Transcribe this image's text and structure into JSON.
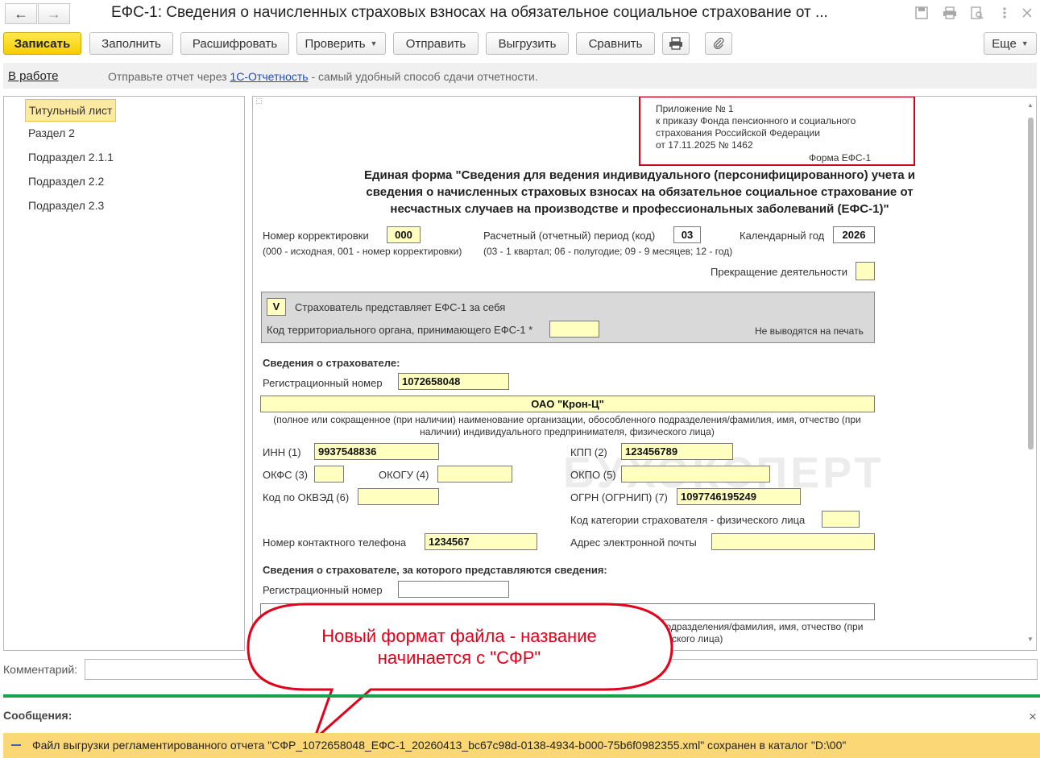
{
  "window": {
    "title": "ЕФС-1: Сведения о начисленных страховых взносах на обязательное социальное страхование от ..."
  },
  "toolbar": {
    "save": "Записать",
    "fill": "Заполнить",
    "decode": "Расшифровать",
    "check": "Проверить",
    "send": "Отправить",
    "export": "Выгрузить",
    "compare": "Сравнить",
    "more": "Еще"
  },
  "infobar": {
    "status_link": "В работе",
    "prefix": "Отправьте отчет через ",
    "link": "1С-Отчетность",
    "suffix": " - самый удобный способ сдачи отчетности."
  },
  "sidebar": {
    "items": [
      {
        "label": "Титульный лист"
      },
      {
        "label": "Раздел 2"
      },
      {
        "label": "Подраздел 2.1.1"
      },
      {
        "label": "Подраздел 2.2"
      },
      {
        "label": "Подраздел 2.3"
      }
    ]
  },
  "form": {
    "appendix": {
      "line1": "Приложение № 1",
      "line2": "к приказу Фонда пенсионного и социального",
      "line3": "страхования Российской Федерации",
      "line4": "от 17.11.2025 № 1462",
      "form_name": "Форма ЕФС-1"
    },
    "heading": {
      "line1": "Единая форма \"Сведения для ведения индивидуального (персонифицированного) учета и",
      "line2": "сведения о начисленных страховых взносах на обязательное социальное страхование от",
      "line3": "несчастных случаев на производстве и профессиональных заболеваний (ЕФС-1)\""
    },
    "correction_label": "Номер корректировки",
    "correction_value": "000",
    "correction_note": "(000 - исходная, 001 - номер корректировки)",
    "period_label": "Расчетный (отчетный) период (код)",
    "period_value": "03",
    "period_note": "(03 - 1 квартал; 06 - полугодие; 09 - 9 месяцев; 12 - год)",
    "year_label": "Календарный год",
    "year_value": "2026",
    "termination_label": "Прекращение деятельности",
    "gray_box": {
      "check_mark": "V",
      "check_label": "Страхователь представляет ЕФС-1 за себя",
      "territorial_label": "Код территориального органа, принимающего ЕФС-1 *",
      "no_print": "Не выводятся на печать"
    },
    "insurer_heading": "Сведения о страхователе:",
    "reg_number_label": "Регистрационный номер",
    "reg_number_value": "1072658048",
    "org_name": "ОАО \"Крон-Ц\"",
    "org_name_note_line1": "(полное или сокращенное (при наличии) наименование организации, обособленного подразделения/фамилия, имя, отчество (при",
    "org_name_note_line2": "наличии) индивидуального предпринимателя, физического лица)",
    "inn_label": "ИНН (1)",
    "inn_value": "9937548836",
    "kpp_label": "КПП (2)",
    "kpp_value": "123456789",
    "okfs_label": "ОКФС (3)",
    "okogu_label": "ОКОГУ (4)",
    "okpo_label": "ОКПО (5)",
    "okved_label": "Код по ОКВЭД (6)",
    "ogrn_label": "ОГРН (ОГРНИП) (7)",
    "ogrn_value": "1097746195249",
    "category_label": "Код категории страхователя - физического лица",
    "phone_label": "Номер контактного телефона",
    "phone_value": "1234567",
    "email_label": "Адрес электронной почты",
    "represented_heading": "Сведения о страхователе, за которого представляются сведения:",
    "rep_reg_label": "Регистрационный номер",
    "rep_note_line1": "подразделения/фамилия, имя, отчество (при",
    "rep_note_line2": "ского лица)"
  },
  "comment_label": "Комментарий:",
  "messages": {
    "header": "Сообщения:",
    "close": "×",
    "text": "Файл выгрузки регламентированного отчета \"СФР_1072658048_ЕФС-1_20260413_bc67c98d-0138-4934-b000-75b6f0982355.xml\" сохранен в каталог \"D:\\00\""
  },
  "callout": {
    "line1": "Новый формат файла - название",
    "line2": "начинается с \"СФР\""
  },
  "watermark": "БУХЭКСПЕРТ",
  "colors": {
    "accent_yellow": "#f5cf00",
    "field_yellow": "#ffffc0",
    "callout_red": "#e3001b",
    "message_bar": "#fbd776",
    "separator_green": "#1aa14b"
  }
}
